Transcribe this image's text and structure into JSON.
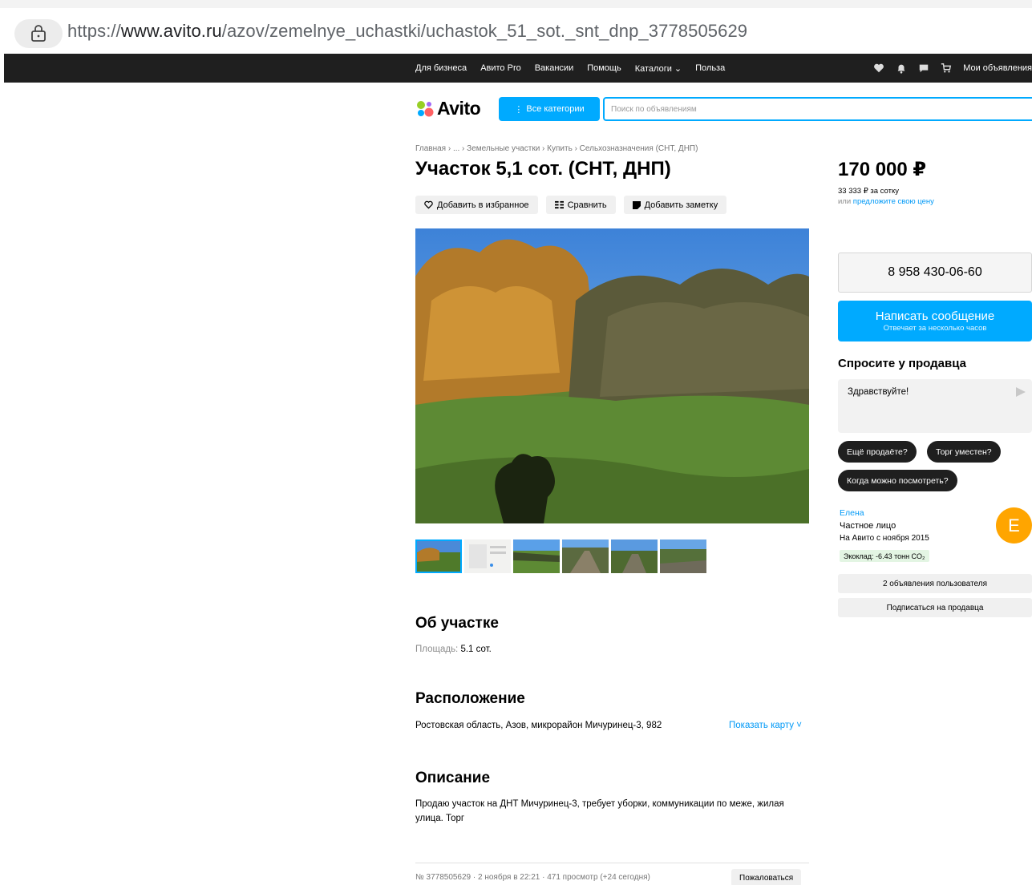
{
  "browser": {
    "url_scheme": "https://",
    "url_host": "www.avito.ru",
    "url_path": "/azov/zemelnye_uchastki/uchastok_51_sot._snt_dnp_3778505629"
  },
  "topnav": {
    "links": [
      "Для бизнеса",
      "Авито Pro",
      "Вакансии",
      "Помощь",
      "Каталоги ⌄",
      "Польза"
    ],
    "my_ads": "Мои объявления"
  },
  "header": {
    "logo": "Avito",
    "categories_btn": "Все категории",
    "search_placeholder": "Поиск по объявлениям"
  },
  "breadcrumb": "Главная › ... › Земельные участки › Купить › Сельхозназначения (СНТ, ДНП)",
  "listing": {
    "title": "Участок 5,1 сот. (СНТ, ДНП)",
    "actions": {
      "favorite": "Добавить в избранное",
      "compare": "Сравнить",
      "note": "Добавить заметку"
    }
  },
  "about": {
    "heading": "Об участке",
    "area_label": "Площадь:",
    "area_value": "5.1 сот."
  },
  "location": {
    "heading": "Расположение",
    "address": "Ростовская область, Азов, микрорайон Мичуринец-3, 982",
    "show_map": "Показать карту ˅"
  },
  "description": {
    "heading": "Описание",
    "text": "Продаю участок на ДНТ Мичуринец-3, требует уборки, коммуникации по меже, жилая улица. Торг"
  },
  "footer": {
    "meta": "№ 3778505629 · 2 ноября в 22:21 · 471 просмотр (+24 сегодня)",
    "report": "Пожаловаться"
  },
  "sidebar": {
    "price": "170 000 ₽",
    "per_sotka": "33 333 ₽ за сотку",
    "offer_prefix": "или ",
    "offer_link": "предложите свою цену",
    "phone": "8 958 430-06-60",
    "message_btn": "Написать сообщение",
    "message_sub": "Отвечает за несколько часов",
    "ask_heading": "Спросите у продавца",
    "ask_text": "Здравствуйте!",
    "chips": [
      "Ещё продаёте?",
      "Торг уместен?",
      "Когда можно посмотреть?"
    ],
    "seller_name": "Елена",
    "seller_type": "Частное лицо",
    "seller_since": "На Авито с ноября 2015",
    "eco": "Экоклад: -6.43 тонн CO₂",
    "avatar_letter": "Е",
    "other_ads": "2 объявления пользователя",
    "subscribe": "Подписаться на продавца"
  },
  "colors": {
    "accent": "#00aaff",
    "link": "#0099f7",
    "topnav_bg": "#1f1f1f",
    "avatar": "#ffa500"
  }
}
